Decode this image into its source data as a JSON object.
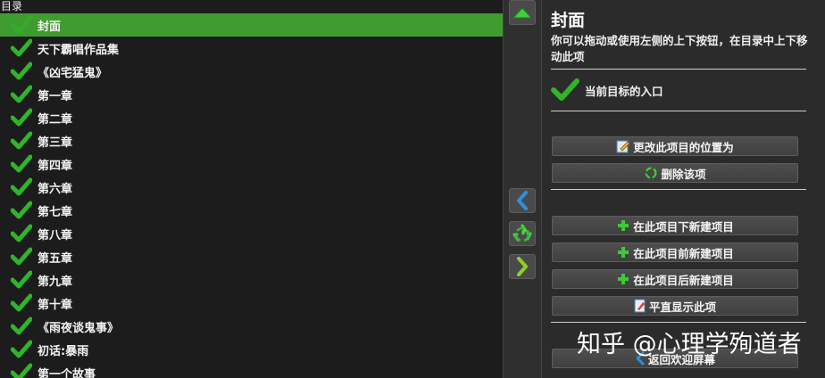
{
  "toc": {
    "header": "目录",
    "items": [
      {
        "label": "封面",
        "selected": true
      },
      {
        "label": "天下霸唱作品集",
        "selected": false
      },
      {
        "label": "《凶宅猛鬼》",
        "selected": false
      },
      {
        "label": "第一章",
        "selected": false
      },
      {
        "label": "第二章",
        "selected": false
      },
      {
        "label": "第三章",
        "selected": false
      },
      {
        "label": "第四章",
        "selected": false
      },
      {
        "label": "第六章",
        "selected": false
      },
      {
        "label": "第七章",
        "selected": false
      },
      {
        "label": "第八章",
        "selected": false
      },
      {
        "label": "第五章",
        "selected": false
      },
      {
        "label": "第九章",
        "selected": false
      },
      {
        "label": "第十章",
        "selected": false
      },
      {
        "label": "《雨夜谈鬼事》",
        "selected": false
      },
      {
        "label": "初话:暴雨",
        "selected": false
      },
      {
        "label": "第一个故事",
        "selected": false
      }
    ]
  },
  "panel": {
    "title": "封面",
    "description": "你可以拖动或使用左侧的上下按钮，在目录中上下移动此项",
    "entry_label": "当前目标的入口",
    "buttons": {
      "change_position": "更改此项目的位置为",
      "delete": "删除该项",
      "new_below": "在此项目下新建项目",
      "new_before": "在此项目前新建项目",
      "new_after": "在此项目后新建项目",
      "flatten": "平直显示此项",
      "back": "返回欢迎屏幕"
    }
  },
  "watermark": "知乎 @心理学殉道者",
  "colors": {
    "selected_row": "#3f9d2f",
    "check_green": "#2fb52a",
    "toc_bg": "#1c1c1c",
    "panel_bg": "#2b2b2b"
  },
  "icons": {
    "check": "check-icon",
    "up": "arrow-up-icon",
    "left": "chevron-left-icon",
    "recycle": "recycle-icon",
    "right": "chevron-right-icon",
    "plus": "plus-icon",
    "edit": "edit-icon"
  }
}
